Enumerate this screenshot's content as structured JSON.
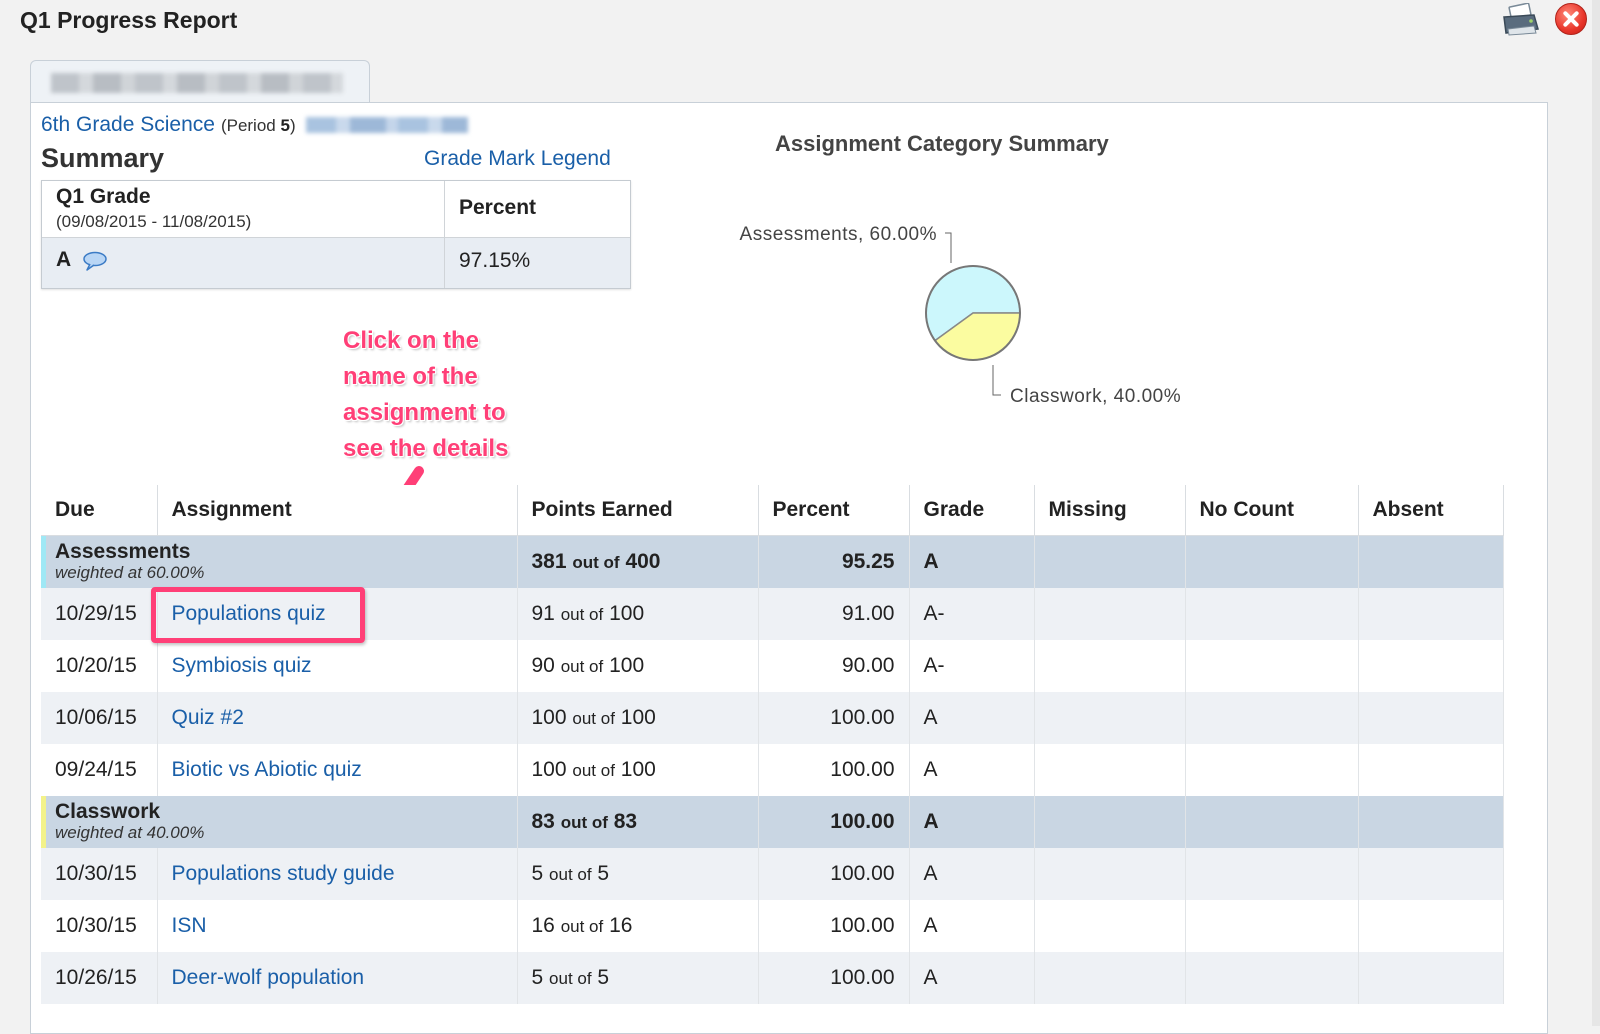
{
  "window": {
    "title": "Q1 Progress Report"
  },
  "course": {
    "name": "6th Grade Science",
    "period_prefix": "(Period ",
    "period_number": "5",
    "period_suffix": ")"
  },
  "summary": {
    "heading": "Summary",
    "legend_link": "Grade Mark Legend",
    "grade_header": "Q1 Grade",
    "date_range": "(09/08/2015 - 11/08/2015)",
    "percent_header": "Percent",
    "grade": "A",
    "percent": "97.15%"
  },
  "pie": {
    "title": "Assignment Category Summary",
    "colors": {
      "assessments": "#ccf7fc",
      "classwork": "#fbfca0",
      "outline": "#888888"
    }
  },
  "chart_data": {
    "type": "pie",
    "title": "Assignment Category Summary",
    "categories": [
      "Assessments",
      "Classwork"
    ],
    "values": [
      60.0,
      40.0
    ],
    "labels": [
      "Assessments, 60.00%",
      "Classwork, 40.00%"
    ]
  },
  "annotation": {
    "lines": [
      "Click on the",
      "name of the",
      "assignment to",
      "see the details"
    ],
    "color": "#ff3f77"
  },
  "table": {
    "headers": [
      "Due",
      "Assignment",
      "Points Earned",
      "Percent",
      "Grade",
      "Missing",
      "No Count",
      "Absent"
    ],
    "out_of_word": "out of",
    "categories": [
      {
        "name": "Assessments",
        "weight": "weighted at 60.00%",
        "bar_color": "#9fe8f5",
        "earned": "381",
        "possible": "400",
        "percent": "95.25",
        "grade": "A",
        "rows": [
          {
            "due": "10/29/15",
            "assignment": "Populations quiz",
            "earned": "91",
            "possible": "100",
            "percent": "91.00",
            "grade": "A-"
          },
          {
            "due": "10/20/15",
            "assignment": "Symbiosis quiz",
            "earned": "90",
            "possible": "100",
            "percent": "90.00",
            "grade": "A-"
          },
          {
            "due": "10/06/15",
            "assignment": "Quiz #2",
            "earned": "100",
            "possible": "100",
            "percent": "100.00",
            "grade": "A"
          },
          {
            "due": "09/24/15",
            "assignment": "Biotic vs Abiotic quiz",
            "earned": "100",
            "possible": "100",
            "percent": "100.00",
            "grade": "A"
          }
        ]
      },
      {
        "name": "Classwork",
        "weight": "weighted at 40.00%",
        "bar_color": "#f3f28a",
        "earned": "83",
        "possible": "83",
        "percent": "100.00",
        "grade": "A",
        "rows": [
          {
            "due": "10/30/15",
            "assignment": "Populations study guide",
            "earned": "5",
            "possible": "5",
            "percent": "100.00",
            "grade": "A"
          },
          {
            "due": "10/30/15",
            "assignment": "ISN",
            "earned": "16",
            "possible": "16",
            "percent": "100.00",
            "grade": "A"
          },
          {
            "due": "10/26/15",
            "assignment": "Deer-wolf population",
            "earned": "5",
            "possible": "5",
            "percent": "100.00",
            "grade": "A"
          }
        ]
      }
    ]
  }
}
